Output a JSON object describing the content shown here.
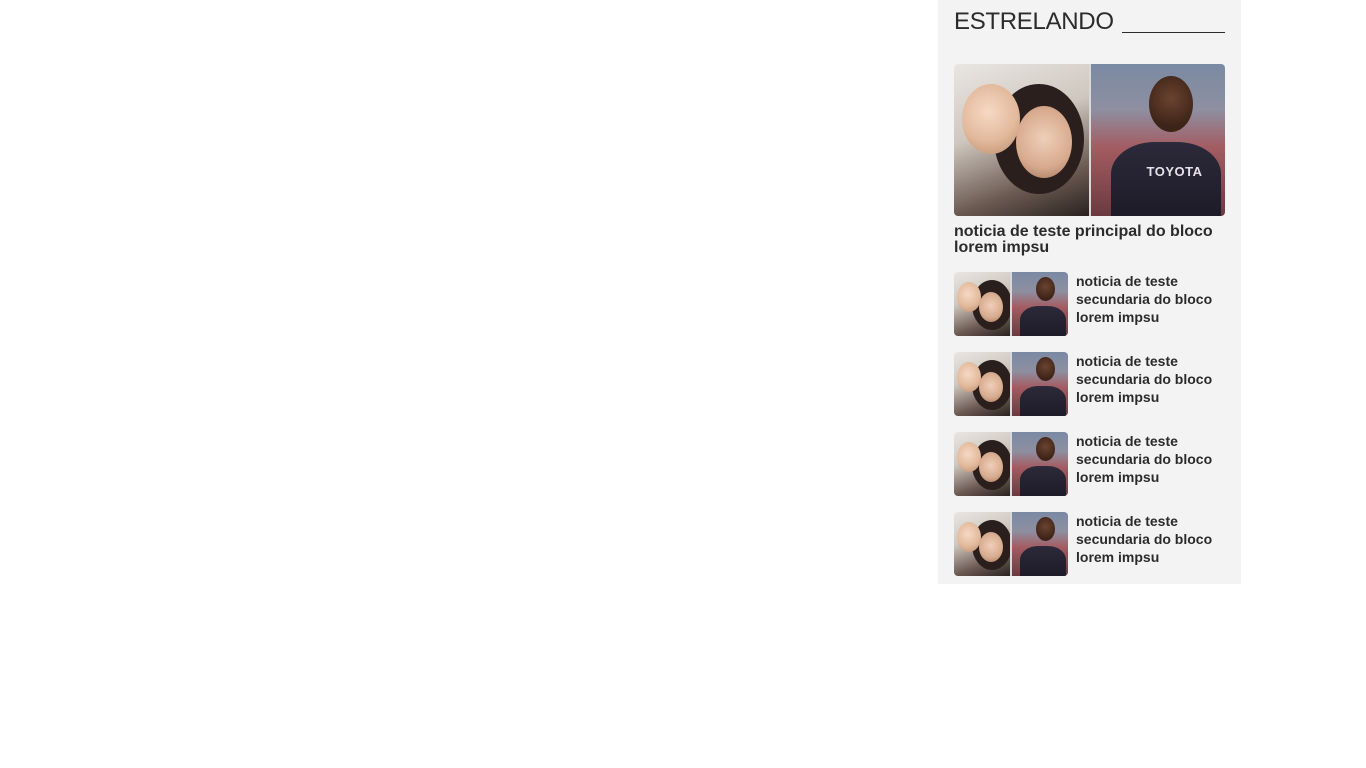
{
  "section": {
    "title": "ESTRELANDO"
  },
  "main_story": {
    "title": "noticia de teste principal do bloco lorem impsu",
    "image_logo": "TOYOTA"
  },
  "secondary_stories": [
    {
      "title": "noticia de teste secundaria do bloco lorem impsu"
    },
    {
      "title": "noticia de teste secundaria do bloco lorem impsu"
    },
    {
      "title": "noticia de teste secundaria do bloco lorem impsu"
    },
    {
      "title": "noticia de teste secundaria do bloco lorem impsu"
    }
  ],
  "colors": {
    "sidebar_background": "#f3f3f3",
    "text": "#2b2b2b"
  }
}
